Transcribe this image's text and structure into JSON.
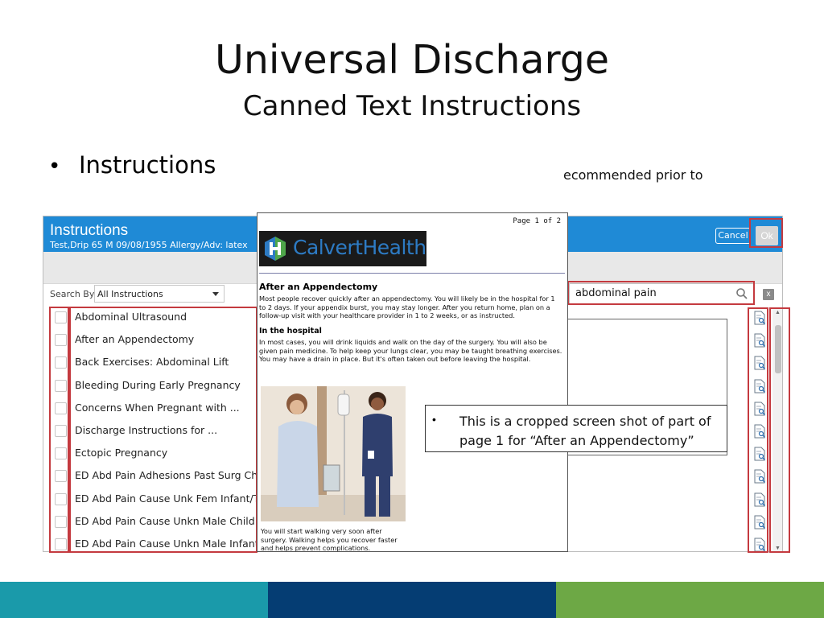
{
  "slide": {
    "title": "Universal Discharge",
    "subtitle": "Canned Text Instructions",
    "bullet": "Instructions"
  },
  "app": {
    "title": "Instructions",
    "patient_info": "Test,Drip  65  M  09/08/1955   Allergy/Adv: latex",
    "cancel_label": "Cancel",
    "ok_label": "Ok",
    "search_by_label": "Search By",
    "search_by_value": "All Instructions",
    "search_value": "abdominal pain",
    "clear_label": "x",
    "instructions": [
      "Abdominal Ultrasound",
      "After an Appendectomy",
      "Back Exercises: Abdominal Lift",
      "Bleeding During Early Pregnancy",
      "Concerns When Pregnant with ...",
      "Discharge Instructions for ...",
      "Ectopic Pregnancy",
      "ED Abd Pain Adhesions Past Surg Child",
      "ED Abd Pain Cause Unk Fem Infant/Tod",
      "ED Abd Pain Cause Unkn Male Child",
      "ED Abd Pain Cause Unkn Male Infant/To"
    ],
    "hidden_text_fragment": "ecommended prior to"
  },
  "preview": {
    "page_label": "Page 1 of 2",
    "logo_text": "CalvertHealth",
    "heading": "After an Appendectomy",
    "para1": "Most people recover quickly after an appendectomy. You will likely be in the hospital for 1 to 2 days. If your appendix burst, you may stay longer. After you return home, plan on a follow-up visit with your healthcare provider in 1 to 2 weeks, or as instructed.",
    "subheading": "In the hospital",
    "para2": "In most cases, you will drink liquids and walk on the day of the surgery. You will also be given pain medicine. To help keep your lungs clear, you may be taught breathing exercises. You may have a drain in place. But it's often taken out before leaving the hospital.",
    "caption": "You will start walking very soon after surgery. Walking helps you recover faster and helps prevent complications."
  },
  "callout": {
    "text": "This is a cropped screen shot of part of page 1 for “After an Appendectomy”"
  },
  "colors": {
    "header_blue": "#1f8ad6",
    "highlight_red": "#c43a3f",
    "footer_teal": "#1a9aaa",
    "footer_navy": "#053d73",
    "footer_green": "#6da845"
  }
}
